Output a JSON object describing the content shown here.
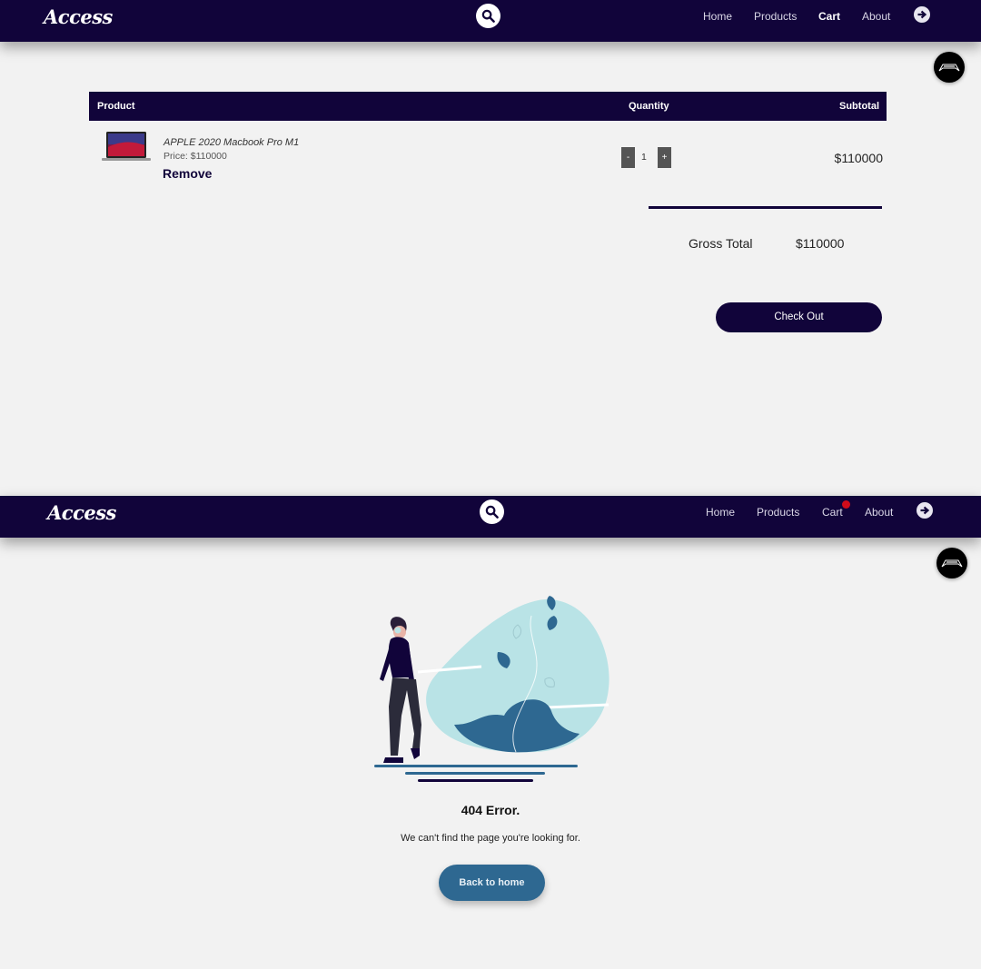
{
  "brand": {
    "logo_text": "Access"
  },
  "nav": {
    "home": "Home",
    "products": "Products",
    "cart": "Cart",
    "about": "About"
  },
  "colors": {
    "navbar": "#11043a",
    "primary_button": "#11043a",
    "home_button": "#2e6891",
    "badge": "#d10b1a"
  },
  "icons": {
    "search": "search-icon",
    "logout": "arrow-right-circle-icon",
    "avatar": "user-avatar"
  },
  "cart": {
    "headers": {
      "product": "Product",
      "quantity": "Quantity",
      "subtotal": "Subtotal"
    },
    "items": [
      {
        "name": "APPLE 2020 Macbook Pro M1",
        "price": "Price: $110000",
        "remove": "Remove",
        "quantity": "1",
        "decrement": "-",
        "increment": "+",
        "subtotal": "$110000"
      }
    ],
    "gross_label": "Gross Total",
    "gross_value": "$110000",
    "checkout": "Check Out"
  },
  "error_page": {
    "title": "404 Error.",
    "message": "We can't find the page you're looking for.",
    "button": "Back to home"
  }
}
